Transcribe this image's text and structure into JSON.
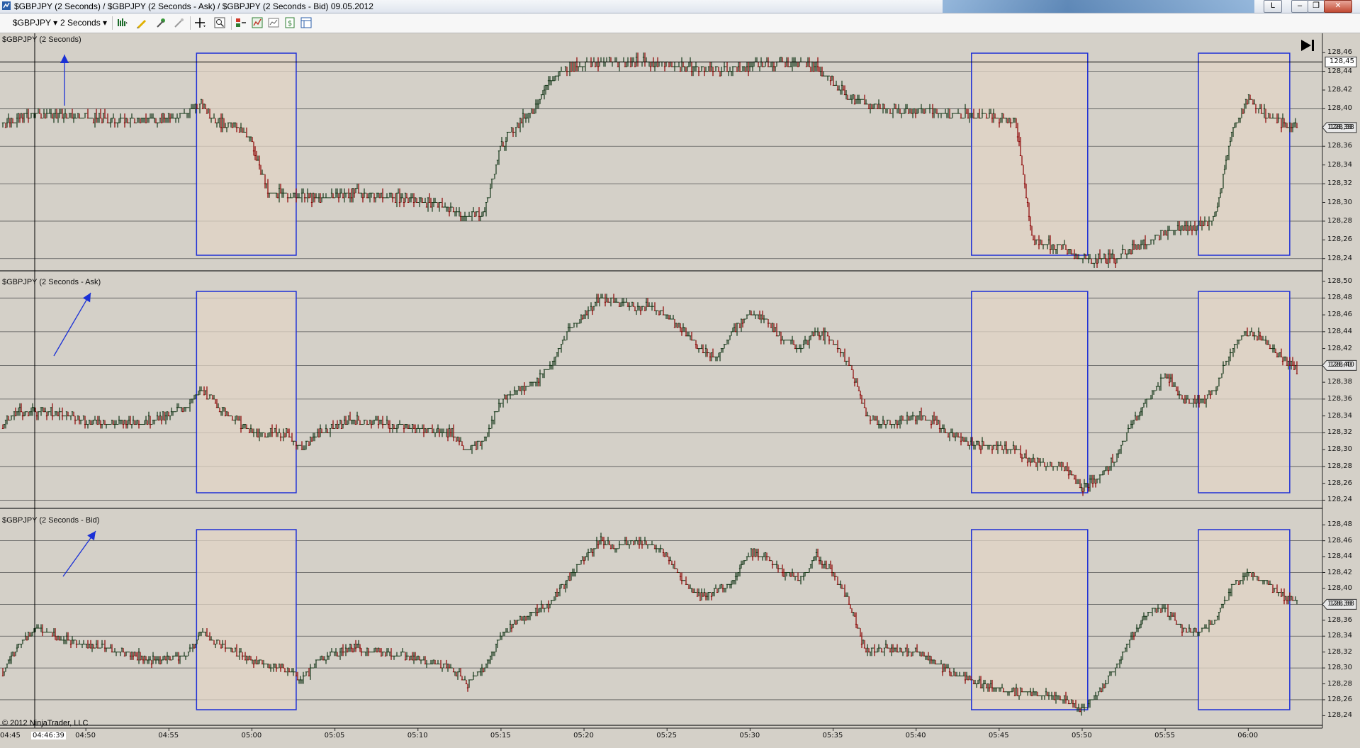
{
  "window": {
    "title": "$GBPJPY (2 Seconds) / $GBPJPY (2 Seconds - Ask) / $GBPJPY (2 Seconds - Bid)  09.05.2012",
    "buttons": {
      "layout": "L",
      "minimize": "–",
      "restore": "❐",
      "close": "✕"
    }
  },
  "toolbar": {
    "instrument": "$GBPJPY",
    "interval": "2 Seconds",
    "icons": [
      "bar-style-icon",
      "drawing-tool-icon",
      "chart-trader-icon",
      "crosshair-icon",
      "zoom-icon",
      "indicators-icon",
      "strategies-icon",
      "data-box-icon",
      "dollar-icon",
      "properties-icon"
    ]
  },
  "colors": {
    "background": "#d4d0c8",
    "up_bar": "#16381a",
    "down_bar": "#8b0000",
    "highlight_box_fill": "#e2d4c6",
    "highlight_box_stroke": "#1f2fd6",
    "arrow": "#1a30d6",
    "current_price_tag": "#e8e8e8"
  },
  "panels": [
    {
      "label": "$GBPJPY (2 Seconds)",
      "current_price": "128,38",
      "top_price_tag": "128,45",
      "y_ticks": [
        "128,46",
        "128,44",
        "128,42",
        "128,40",
        "128,38",
        "128,36",
        "128,34",
        "128,32",
        "128,30",
        "128,28",
        "128,26",
        "128,24"
      ]
    },
    {
      "label": "$GBPJPY (2 Seconds - Ask)",
      "current_price": "128,40",
      "y_ticks": [
        "128,50",
        "128,48",
        "128,46",
        "128,44",
        "128,42",
        "128,40",
        "128,38",
        "128,36",
        "128,34",
        "128,32",
        "128,30",
        "128,28",
        "128,26",
        "128,24"
      ]
    },
    {
      "label": "$GBPJPY (2 Seconds - Bid)",
      "current_price": "128,38",
      "y_ticks": [
        "128,48",
        "128,46",
        "128,44",
        "128,42",
        "128,40",
        "128,38",
        "128,36",
        "128,34",
        "128,32",
        "128,30",
        "128,28",
        "128,26",
        "128,24"
      ]
    }
  ],
  "x_axis": {
    "crosshair_time": "04:46:39",
    "first_label": "04:45",
    "labels": [
      "04:50",
      "04:55",
      "05:00",
      "05:05",
      "05:10",
      "05:15",
      "05:20",
      "05:25",
      "05:30",
      "05:35",
      "05:40",
      "05:45",
      "05:50",
      "05:55",
      "06:00"
    ]
  },
  "copyright": "© 2012 NinjaTrader, LLC",
  "chart_data": {
    "type": "bar",
    "title": "$GBPJPY (2 Seconds) / $GBPJPY (2 Seconds - Ask) / $GBPJPY (2 Seconds - Bid)  09.05.2012",
    "xlabel": "",
    "ylabel": "",
    "x_start_label": "04:45",
    "x_end": "06:04",
    "highlight_ranges_time": [
      [
        "04:56:40",
        "05:02:40"
      ],
      [
        "05:43:20",
        "05:50:20"
      ],
      [
        "05:57:00",
        "06:02:30"
      ]
    ],
    "series": [
      {
        "ylim": [
          128.233,
          128.473
        ],
        "points": [
          [
            "04:45",
            128.385
          ],
          [
            "04:47",
            128.395
          ],
          [
            "04:49",
            128.392
          ],
          [
            "04:52",
            128.388
          ],
          [
            "04:55",
            128.39
          ],
          [
            "04:56",
            128.395
          ],
          [
            "04:57",
            128.405
          ],
          [
            "04:58",
            128.385
          ],
          [
            "04:59",
            128.383
          ],
          [
            "05:00",
            128.365
          ],
          [
            "05:01",
            128.31
          ],
          [
            "05:04",
            128.305
          ],
          [
            "05:06",
            128.31
          ],
          [
            "05:09",
            128.305
          ],
          [
            "05:11",
            128.3
          ],
          [
            "05:13",
            128.285
          ],
          [
            "05:14",
            128.29
          ],
          [
            "05:15",
            128.36
          ],
          [
            "05:16",
            128.385
          ],
          [
            "05:17",
            128.4
          ],
          [
            "05:18",
            128.43
          ],
          [
            "05:19",
            128.445
          ],
          [
            "05:20",
            128.448
          ],
          [
            "05:22",
            128.45
          ],
          [
            "05:24",
            128.45
          ],
          [
            "05:26",
            128.445
          ],
          [
            "05:28",
            128.44
          ],
          [
            "05:30",
            128.445
          ],
          [
            "05:32",
            128.45
          ],
          [
            "05:34",
            128.445
          ],
          [
            "05:35",
            128.43
          ],
          [
            "05:36",
            128.41
          ],
          [
            "05:38",
            128.4
          ],
          [
            "05:40",
            128.398
          ],
          [
            "05:42",
            128.395
          ],
          [
            "05:44",
            128.392
          ],
          [
            "05:46",
            128.388
          ],
          [
            "05:47",
            128.26
          ],
          [
            "05:49",
            128.25
          ],
          [
            "05:50",
            128.24
          ],
          [
            "05:52",
            128.24
          ],
          [
            "05:53",
            128.25
          ],
          [
            "05:55",
            128.268
          ],
          [
            "05:57",
            128.275
          ],
          [
            "05:58",
            128.282
          ],
          [
            "05:59",
            128.375
          ],
          [
            "06:00",
            128.41
          ],
          [
            "06:01",
            128.395
          ],
          [
            "06:02",
            128.385
          ],
          [
            "06:03",
            128.38
          ]
        ]
      },
      {
        "ylim": [
          128.237,
          128.503
        ],
        "points": [
          [
            "04:45",
            128.33
          ],
          [
            "04:46",
            128.345
          ],
          [
            "04:48",
            128.345
          ],
          [
            "04:50",
            128.335
          ],
          [
            "04:52",
            128.33
          ],
          [
            "04:54",
            128.335
          ],
          [
            "04:56",
            128.35
          ],
          [
            "04:57",
            128.37
          ],
          [
            "04:58",
            128.35
          ],
          [
            "04:59",
            128.335
          ],
          [
            "05:00",
            128.32
          ],
          [
            "05:02",
            128.32
          ],
          [
            "05:03",
            128.3
          ],
          [
            "05:04",
            128.32
          ],
          [
            "05:06",
            128.335
          ],
          [
            "05:08",
            128.33
          ],
          [
            "05:10",
            128.325
          ],
          [
            "05:12",
            128.32
          ],
          [
            "05:13",
            128.3
          ],
          [
            "05:14",
            128.31
          ],
          [
            "05:15",
            128.36
          ],
          [
            "05:17",
            128.38
          ],
          [
            "05:18",
            128.4
          ],
          [
            "05:19",
            128.44
          ],
          [
            "05:20",
            128.46
          ],
          [
            "05:21",
            128.48
          ],
          [
            "05:23",
            128.47
          ],
          [
            "05:24",
            128.47
          ],
          [
            "05:25",
            128.46
          ],
          [
            "05:26",
            128.44
          ],
          [
            "05:27",
            128.42
          ],
          [
            "05:28",
            128.41
          ],
          [
            "05:29",
            128.44
          ],
          [
            "05:30",
            128.465
          ],
          [
            "05:31",
            128.455
          ],
          [
            "05:32",
            128.43
          ],
          [
            "05:33",
            128.42
          ],
          [
            "05:34",
            128.44
          ],
          [
            "05:35",
            128.43
          ],
          [
            "05:36",
            128.4
          ],
          [
            "05:37",
            128.34
          ],
          [
            "05:38",
            128.33
          ],
          [
            "05:40",
            128.34
          ],
          [
            "05:41",
            128.335
          ],
          [
            "05:42",
            128.32
          ],
          [
            "05:43",
            128.31
          ],
          [
            "05:44",
            128.305
          ],
          [
            "05:46",
            128.3
          ],
          [
            "05:47",
            128.285
          ],
          [
            "05:49",
            128.28
          ],
          [
            "05:50",
            128.255
          ],
          [
            "05:51",
            128.265
          ],
          [
            "05:52",
            128.29
          ],
          [
            "05:53",
            128.33
          ],
          [
            "05:54",
            128.36
          ],
          [
            "05:55",
            128.39
          ],
          [
            "05:56",
            128.36
          ],
          [
            "05:57",
            128.355
          ],
          [
            "05:58",
            128.37
          ],
          [
            "05:59",
            128.42
          ],
          [
            "06:00",
            128.44
          ],
          [
            "06:01",
            128.43
          ],
          [
            "06:02",
            128.41
          ],
          [
            "06:03",
            128.395
          ]
        ]
      },
      {
        "ylim": [
          128.235,
          128.49
        ],
        "points": [
          [
            "04:45",
            128.295
          ],
          [
            "04:46",
            128.33
          ],
          [
            "04:47",
            128.35
          ],
          [
            "04:48",
            128.34
          ],
          [
            "04:50",
            128.33
          ],
          [
            "04:52",
            128.32
          ],
          [
            "04:54",
            128.31
          ],
          [
            "04:56",
            128.315
          ],
          [
            "04:57",
            128.345
          ],
          [
            "04:58",
            128.33
          ],
          [
            "04:59",
            128.32
          ],
          [
            "05:00",
            128.31
          ],
          [
            "05:02",
            128.3
          ],
          [
            "05:03",
            128.285
          ],
          [
            "05:04",
            128.31
          ],
          [
            "05:06",
            128.325
          ],
          [
            "05:08",
            128.32
          ],
          [
            "05:10",
            128.31
          ],
          [
            "05:12",
            128.3
          ],
          [
            "05:13",
            128.28
          ],
          [
            "05:14",
            128.3
          ],
          [
            "05:15",
            128.34
          ],
          [
            "05:16",
            128.36
          ],
          [
            "05:17",
            128.37
          ],
          [
            "05:18",
            128.38
          ],
          [
            "05:19",
            128.41
          ],
          [
            "05:20",
            128.44
          ],
          [
            "05:21",
            128.46
          ],
          [
            "05:22",
            128.45
          ],
          [
            "05:23",
            128.46
          ],
          [
            "05:24",
            128.455
          ],
          [
            "05:25",
            128.44
          ],
          [
            "05:26",
            128.41
          ],
          [
            "05:27",
            128.39
          ],
          [
            "05:28",
            128.395
          ],
          [
            "05:29",
            128.41
          ],
          [
            "05:30",
            128.445
          ],
          [
            "05:31",
            128.44
          ],
          [
            "05:32",
            128.42
          ],
          [
            "05:33",
            128.41
          ],
          [
            "05:34",
            128.44
          ],
          [
            "05:35",
            128.42
          ],
          [
            "05:36",
            128.38
          ],
          [
            "05:37",
            128.32
          ],
          [
            "05:38",
            128.325
          ],
          [
            "05:40",
            128.32
          ],
          [
            "05:41",
            128.31
          ],
          [
            "05:42",
            128.295
          ],
          [
            "05:43",
            128.285
          ],
          [
            "05:44",
            128.28
          ],
          [
            "05:46",
            128.27
          ],
          [
            "05:48",
            128.265
          ],
          [
            "05:49",
            128.26
          ],
          [
            "05:50",
            128.245
          ],
          [
            "05:51",
            128.27
          ],
          [
            "05:52",
            128.3
          ],
          [
            "05:53",
            128.34
          ],
          [
            "05:54",
            128.37
          ],
          [
            "05:55",
            128.375
          ],
          [
            "05:56",
            128.35
          ],
          [
            "05:57",
            128.345
          ],
          [
            "05:58",
            128.36
          ],
          [
            "05:59",
            128.4
          ],
          [
            "06:00",
            128.42
          ],
          [
            "06:01",
            128.41
          ],
          [
            "06:02",
            128.39
          ],
          [
            "06:03",
            128.385
          ]
        ]
      }
    ]
  }
}
